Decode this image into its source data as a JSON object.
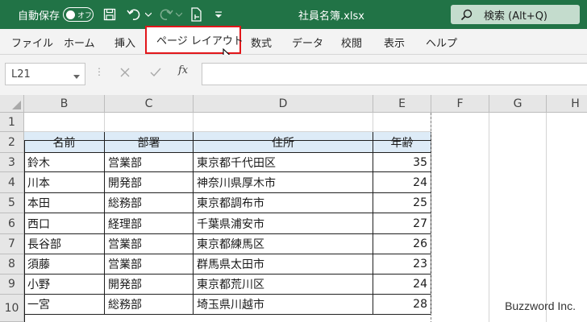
{
  "titlebar": {
    "autosave_label": "自動保存",
    "autosave_state": "オフ",
    "file_name": "社員名簿.xlsx",
    "search_label": "検索 (Alt+Q)"
  },
  "ribbon": {
    "tabs": [
      "ファイル",
      "ホーム",
      "挿入",
      "ページ レイアウト",
      "数式",
      "データ",
      "校閲",
      "表示",
      "ヘルプ"
    ],
    "highlighted_tab": "ページ レイアウト"
  },
  "formula_bar": {
    "name_box": "L21",
    "fx_label": "fx",
    "formula": ""
  },
  "grid": {
    "columns": [
      "B",
      "C",
      "D",
      "E",
      "F",
      "G",
      "H"
    ],
    "rows": [
      "1",
      "2",
      "3",
      "4",
      "5",
      "6",
      "7",
      "8",
      "9",
      "10"
    ],
    "table_headers": [
      "名前",
      "部署",
      "住所",
      "年齢"
    ],
    "table_rows": [
      [
        "鈴木",
        "営業部",
        "東京都千代田区",
        "35"
      ],
      [
        "川本",
        "開発部",
        "神奈川県厚木市",
        "24"
      ],
      [
        "本田",
        "総務部",
        "東京都調布市",
        "25"
      ],
      [
        "西口",
        "経理部",
        "千葉県浦安市",
        "27"
      ],
      [
        "長谷部",
        "営業部",
        "東京都練馬区",
        "26"
      ],
      [
        "須藤",
        "営業部",
        "群馬県太田市",
        "23"
      ],
      [
        "小野",
        "開発部",
        "東京都荒川区",
        "24"
      ],
      [
        "一宮",
        "総務部",
        "埼玉県川越市",
        "28"
      ]
    ]
  },
  "watermark": "Buzzword Inc.",
  "colors": {
    "title_bar": "#217346",
    "header_fill": "#ddebf7",
    "highlight": "#e2161a"
  },
  "icons": [
    "save-icon",
    "undo-icon",
    "redo-icon",
    "touch-mode-icon",
    "customize-toolbar-icon",
    "search-icon",
    "cancel-icon",
    "enter-icon",
    "fx-icon"
  ]
}
